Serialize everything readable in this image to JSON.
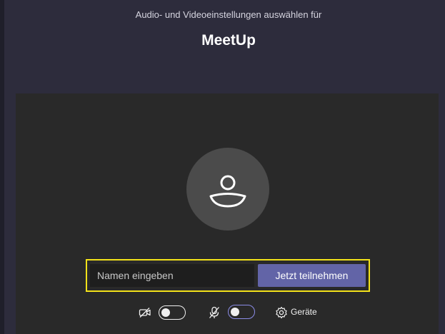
{
  "header": {
    "subtitle": "Audio- und Videoeinstellungen auswählen für",
    "title": "MeetUp"
  },
  "join": {
    "name_placeholder": "Namen eingeben",
    "join_label": "Jetzt teilnehmen"
  },
  "controls": {
    "video_on": false,
    "mic_on": false,
    "devices_label": "Geräte"
  },
  "colors": {
    "accent": "#6264a7",
    "highlight_border": "#f3e21a"
  }
}
